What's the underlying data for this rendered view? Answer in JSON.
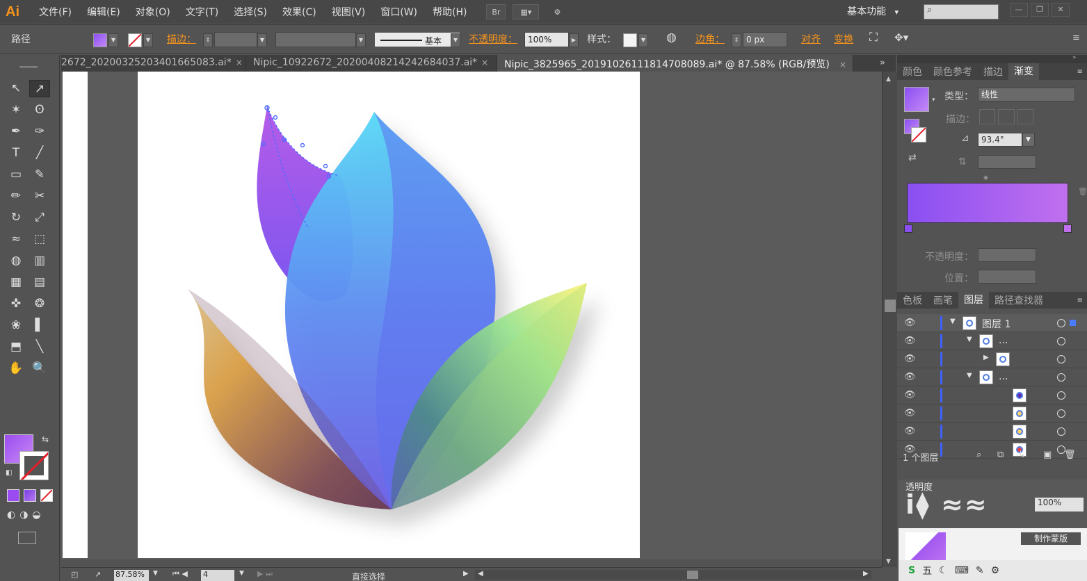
{
  "app": {
    "logo": "Ai"
  },
  "menu": [
    "文件(F)",
    "编辑(E)",
    "对象(O)",
    "文字(T)",
    "选择(S)",
    "效果(C)",
    "视图(V)",
    "窗口(W)",
    "帮助(H)"
  ],
  "menubar_buttons": {
    "bridge": "Br"
  },
  "workspace": {
    "label": "基本功能",
    "caret": "▾"
  },
  "search": {
    "placeholder": ""
  },
  "control": {
    "object_type": "路径",
    "stroke_label": "描边：",
    "stroke_style": "基本",
    "opacity_label": "不透明度：",
    "opacity_value": "100%",
    "style_label": "样式：",
    "corner_label": "边角：",
    "corner_value": "0 px",
    "align_label": "对齐",
    "transform_label": "变换"
  },
  "tabs": [
    {
      "label": "2672_20200325203401665083.ai*",
      "close": "×"
    },
    {
      "label": "Nipic_10922672_20200408214242684037.ai*",
      "close": "×"
    },
    {
      "label": "Nipic_3825965_20191026111814708089.ai* @ 87.58% (RGB/预览)",
      "close": "×"
    }
  ],
  "tab_more": "»",
  "tools": [
    "selection-icon",
    "direct-selection-icon",
    "magic-wand-icon",
    "lasso-icon",
    "pen-icon",
    "curvature-icon",
    "type-icon",
    "line-segment-icon",
    "rectangle-icon",
    "paintbrush-icon",
    "pencil-icon",
    "scissors-icon",
    "rotate-icon",
    "scale-icon",
    "width-icon",
    "free-transform-icon",
    "shape-builder-icon",
    "graph-icon",
    "mesh-icon",
    "gradient-icon",
    "eyedropper-icon",
    "blend-icon",
    "symbol-sprayer-icon",
    "column-graph-icon",
    "artboard-icon",
    "slice-icon",
    "hand-icon",
    "zoom-icon"
  ],
  "tool_glyphs": [
    "↖",
    "↗",
    "✶",
    "ʘ",
    "✒",
    "✑",
    "T",
    "╱",
    "▭",
    "✎",
    "✏",
    "✂",
    "↻",
    "⤢",
    "≈",
    "⬚",
    "◍",
    "▥",
    "▦",
    "▤",
    "✜",
    "❂",
    "❀",
    "▌",
    "⬒",
    "╲",
    "✋",
    "🔍"
  ],
  "status": {
    "zoom": "87.58%",
    "page": "4",
    "tool": "直接选择"
  },
  "gradient_panel": {
    "tabs": [
      "颜色",
      "颜色参考",
      "描边",
      "渐变"
    ],
    "active_tab": "渐变",
    "type_label": "类型：",
    "type_value": "线性",
    "stroke_label": "描边：",
    "angle_value": "93.4°",
    "opacity_label": "不透明度：",
    "position_label": "位置："
  },
  "layers_panel": {
    "tabs": [
      "色板",
      "画笔",
      "图层",
      "路径查找器"
    ],
    "active_tab": "图层",
    "rows": [
      {
        "name": "图层 1",
        "indent": 0,
        "expanded": true
      },
      {
        "name": "...",
        "indent": 1,
        "expanded": true
      },
      {
        "name": "",
        "indent": 2,
        "expanded": false
      },
      {
        "name": "...",
        "indent": 1,
        "expanded": true
      },
      {
        "name": "",
        "indent": 3
      },
      {
        "name": "",
        "indent": 3
      },
      {
        "name": "",
        "indent": 3
      },
      {
        "name": "",
        "indent": 3
      }
    ],
    "footer": "1 个图层"
  },
  "transparency_panel": {
    "title": "透明度",
    "opacity": "100%",
    "mask_button": "制作蒙版"
  },
  "colors": {
    "fill_start": "#9b4cf0",
    "fill_end": "#c78af5",
    "gradient_start": "#8a4ff2",
    "gradient_end": "#c070ee",
    "accent": "#f7941d"
  }
}
